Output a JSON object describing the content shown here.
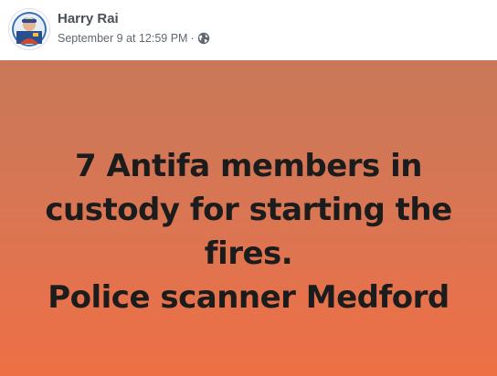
{
  "post": {
    "author": "Harry Rai",
    "timestamp": "September 9 at 12:59 PM",
    "separator": "·",
    "privacy_icon": "globe-icon",
    "avatar_icon": "avatar-photo",
    "image": {
      "background_colors": [
        "#c87858",
        "#d87654",
        "#ef6f45"
      ],
      "text_color": "#1c1c1c",
      "lines": [
        "7 Antifa members  in",
        "custody for starting the",
        "fires.",
        "Police scanner Medford"
      ]
    }
  }
}
